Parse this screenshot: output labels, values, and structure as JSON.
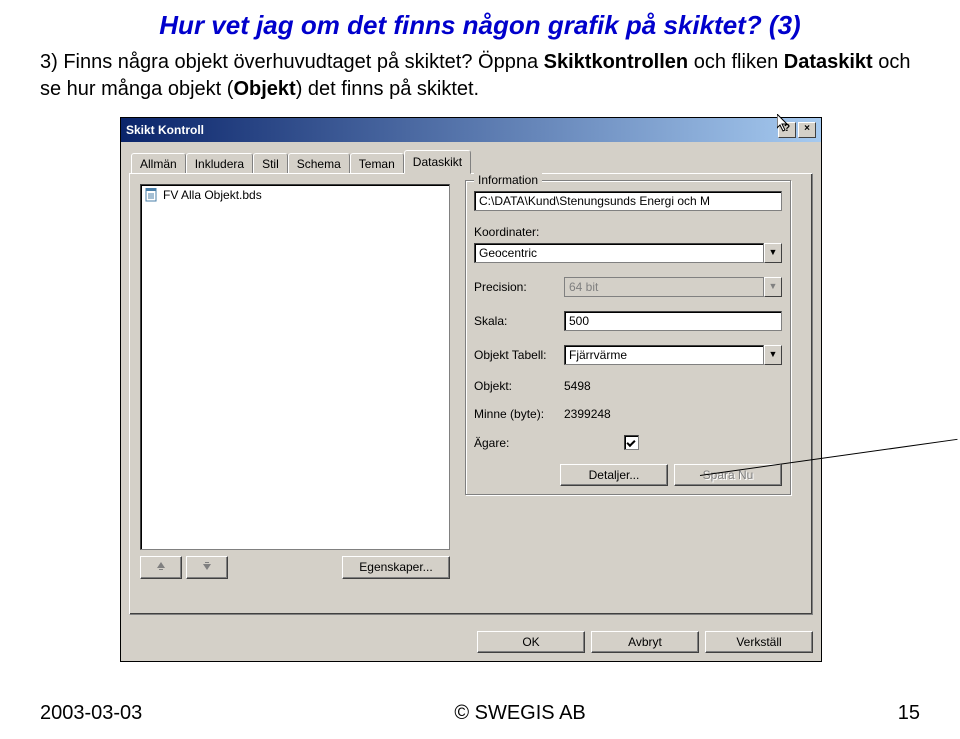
{
  "heading": "Hur vet jag om det finns någon grafik på skiktet? (3)",
  "intro_parts": {
    "p1": "3) Finns några objekt överhuvudtaget på skiktet? Öppna ",
    "b1": "Skiktkontrollen",
    "p2": " och fliken ",
    "b2": "Dataskikt",
    "p3": " och se hur många objekt (",
    "b3": "Objekt",
    "p4": ") det finns på skiktet."
  },
  "dialog": {
    "title": "Skikt Kontroll",
    "help": "?",
    "close": "×",
    "tabs": [
      "Allmän",
      "Inkludera",
      "Stil",
      "Schema",
      "Teman",
      "Dataskikt"
    ],
    "active_tab": 5,
    "list_item": "FV Alla Objekt.bds",
    "btn_properties": "Egenskaper...",
    "group_title": "Information",
    "path_value": "C:\\DATA\\Kund\\Stenungsunds Energi och M",
    "labels": {
      "koord": "Koordinater:",
      "precision": "Precision:",
      "skala": "Skala:",
      "objekttabell": "Objekt Tabell:",
      "objekt": "Objekt:",
      "minne": "Minne (byte):",
      "agare": "Ägare:"
    },
    "values": {
      "koord": "Geocentric",
      "precision": "64 bit",
      "skala": "500",
      "objekttabell": "Fjärrvärme",
      "objekt": "5498",
      "minne": "2399248"
    },
    "btn_details": "Detaljer...",
    "btn_save": "Spara Nu",
    "btn_ok": "OK",
    "btn_cancel": "Avbryt",
    "btn_apply": "Verkställ"
  },
  "footer": {
    "date": "2003-03-03",
    "copyright": "© SWEGIS AB",
    "page": "15"
  }
}
